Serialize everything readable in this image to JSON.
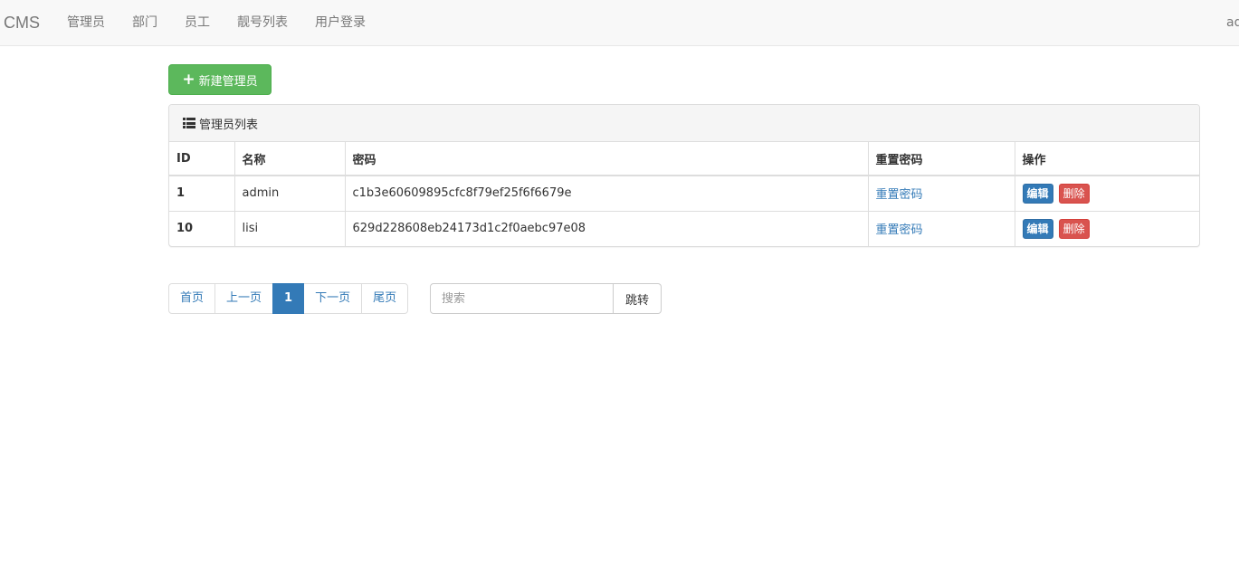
{
  "navbar": {
    "brand": "CMS",
    "items": [
      {
        "label": "管理员"
      },
      {
        "label": "部门"
      },
      {
        "label": "员工"
      },
      {
        "label": "靓号列表"
      },
      {
        "label": "用户登录"
      }
    ],
    "user": "ad"
  },
  "toolbar": {
    "new_label": "新建管理员"
  },
  "panel": {
    "title": "管理员列表",
    "columns": [
      "ID",
      "名称",
      "密码",
      "重置密码",
      "操作"
    ],
    "rows": [
      {
        "id": "1",
        "name": "admin",
        "password": "c1b3e60609895cfc8f79ef25f6f6679e",
        "reset": "重置密码",
        "edit": "编辑",
        "delete": "删除"
      },
      {
        "id": "10",
        "name": "lisi",
        "password": "629d228608eb24173d1c2f0aebc97e08",
        "reset": "重置密码",
        "edit": "编辑",
        "delete": "删除"
      }
    ]
  },
  "pagination": {
    "first": "首页",
    "prev": "上一页",
    "current": "1",
    "next": "下一页",
    "last": "尾页"
  },
  "search": {
    "placeholder": "搜索",
    "button": "跳转"
  },
  "colors": {
    "primary": "#337ab7",
    "success": "#5cb85c",
    "danger": "#d9534f"
  }
}
